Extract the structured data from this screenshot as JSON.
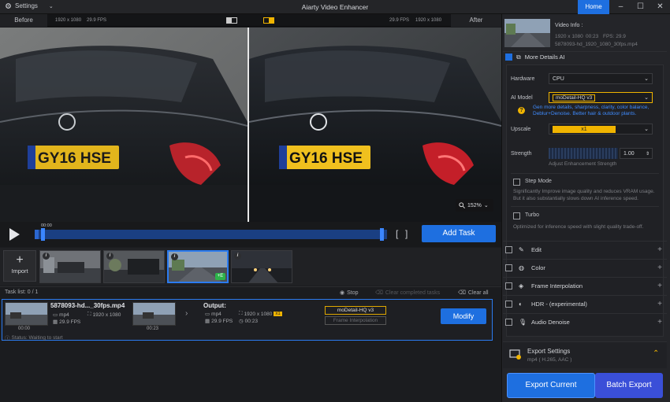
{
  "titlebar": {
    "settings_label": "Settings",
    "app_title": "Aiarty Video Enhancer",
    "home_label": "Home"
  },
  "compare": {
    "before_label": "Before",
    "after_label": "After",
    "left_res": "1920 x 1080",
    "left_fps": "29.9 FPS",
    "right_fps": "29.9 FPS",
    "right_res": "1920 x 1080",
    "plate_text": "GY16 HSE",
    "zoom": "152%"
  },
  "timeline": {
    "time": "00:00",
    "progress": 0.012,
    "add_task_label": "Add Task",
    "bracket_in": "[",
    "bracket_out": "]"
  },
  "clips": {
    "import_label": "Import",
    "selected_badge": "+E"
  },
  "tasks": {
    "header_label": "Task list:",
    "count": "0 / 1",
    "stop_label": "Stop",
    "clear_completed_label": "Clear completed tasks",
    "clear_all_label": "Clear all",
    "item": {
      "filename": "5878093-hd..._30fps.mp4",
      "in_format": "mp4",
      "in_res": "1920 x 1080",
      "in_fps": "29.9 FPS",
      "thumb_start": "00:00",
      "thumb_end": "00:23",
      "output_label": "Output:",
      "out_format": "mp4",
      "out_res": "1920 x 1080",
      "out_scale": "x1",
      "out_fps": "29.9 FPS",
      "out_duration": "00:23",
      "model_tag": "moDetail-HQ  v3",
      "interp_tag": "Frame Interpolation",
      "status": "Status: Waiting to start",
      "modify_label": "Modify"
    }
  },
  "panel": {
    "video_info": {
      "heading": "Video Info :",
      "res": "1920 x 1080",
      "duration": "00:23",
      "fps": "FPS: 29.9",
      "filename": "5878093-hd_1920_1080_30fps.mp4"
    },
    "more_details": {
      "label": "More Details AI",
      "hardware_label": "Hardware",
      "hardware_value": "CPU",
      "model_label": "AI Model",
      "model_value": "moDetail-HQ  v3",
      "model_hint": "Gen more details, sharpness, clarity, color balance, Deblur+Denoise. Better hair & outdoor plants.",
      "upscale_label": "Upscale",
      "upscale_value": "x1",
      "strength_label": "Strength",
      "strength_value": "1.00",
      "strength_caption": "Adjust Enhancement Strength",
      "step_label": "Step Mode",
      "step_desc": "Significantly Improve image quality and reduces VRAM usage. But it also substantially slows down AI inference speed.",
      "turbo_label": "Turbo",
      "turbo_desc": "Optimized for inference speed with slight quality trade-off."
    },
    "sections": [
      {
        "label": "Edit",
        "icon": "edit-icon"
      },
      {
        "label": "Color",
        "icon": "color-icon"
      },
      {
        "label": "Frame Interpolation",
        "icon": "frame-interpolation-icon"
      },
      {
        "label": "HDR - (experimental)",
        "icon": "hdr-icon"
      },
      {
        "label": "Audio Denoise",
        "icon": "audio-denoise-icon"
      }
    ],
    "export": {
      "label": "Export Settings",
      "format": "mp4 ( H.265, AAC )",
      "export_current_label": "Export Current",
      "batch_export_label": "Batch Export"
    }
  },
  "colors": {
    "accent": "#1e6fe0",
    "highlight": "#f0b400",
    "panel": "#242529"
  }
}
